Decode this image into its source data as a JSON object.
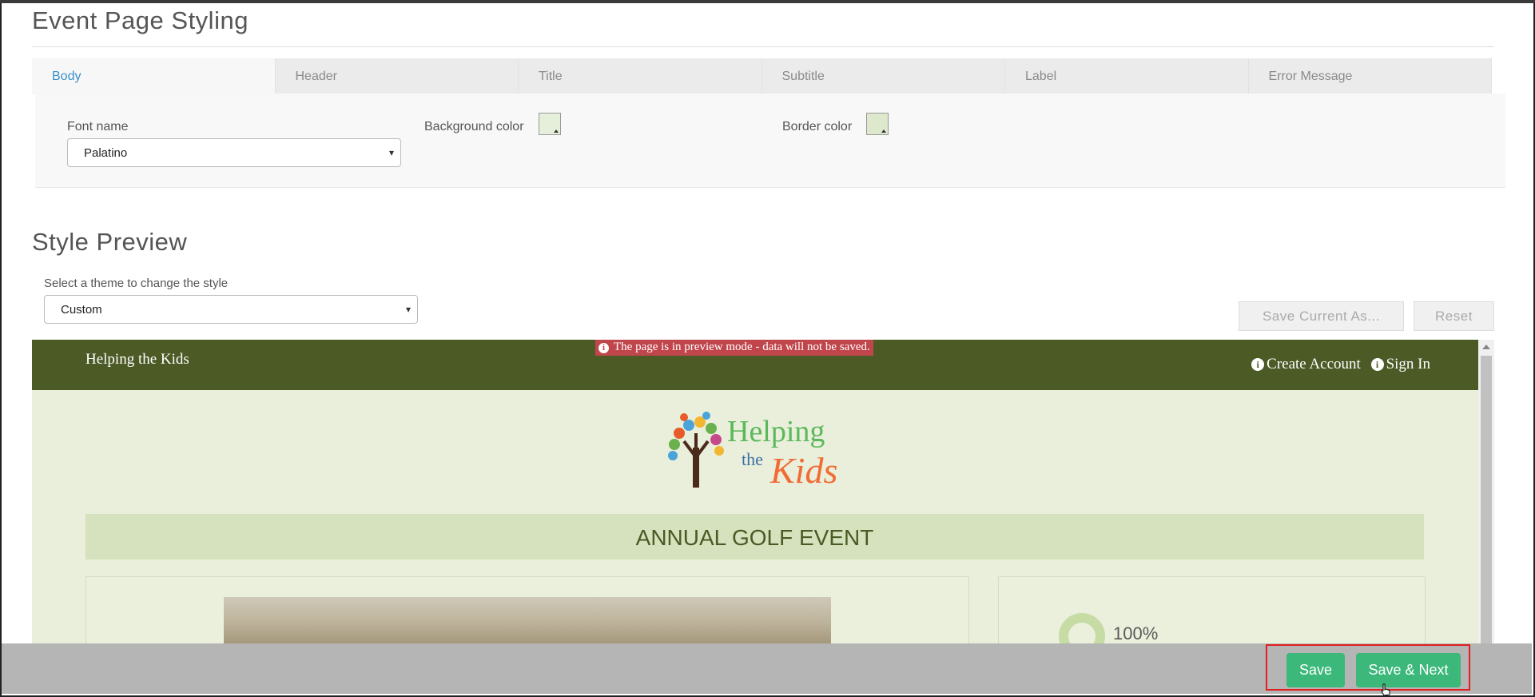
{
  "section": {
    "title": "Event Page Styling"
  },
  "tabs": [
    {
      "label": "Body",
      "active": true
    },
    {
      "label": "Header",
      "active": false
    },
    {
      "label": "Title",
      "active": false
    },
    {
      "label": "Subtitle",
      "active": false
    },
    {
      "label": "Label",
      "active": false
    },
    {
      "label": "Error Message",
      "active": false
    }
  ],
  "body_panel": {
    "font_name_label": "Font name",
    "font_name_value": "Palatino",
    "background_color_label": "Background color",
    "background_color_value": "#e6efd9",
    "border_color_label": "Border color",
    "border_color_value": "#dde8cc"
  },
  "style_preview": {
    "title": "Style Preview",
    "theme_label": "Select a theme to change the style",
    "theme_value": "Custom",
    "save_current_as": "Save Current As...",
    "reset": "Reset"
  },
  "preview": {
    "org_name": "Helping the Kids",
    "banner": "The page is in preview mode - data will not be saved.",
    "create_account": "Create Account",
    "sign_in": "Sign In",
    "logo_word1": "Helping",
    "logo_word2": "the",
    "logo_word3": "Kids",
    "event_title": "ANNUAL GOLF EVENT",
    "progress_pct": "100%",
    "colors": {
      "header": "#4c5a26",
      "body": "#e9efda",
      "title_bar": "#d5e2bd",
      "banner": "#c0464c"
    }
  },
  "actions": {
    "save": "Save",
    "save_next": "Save & Next",
    "button_color": "#3bb87a"
  }
}
